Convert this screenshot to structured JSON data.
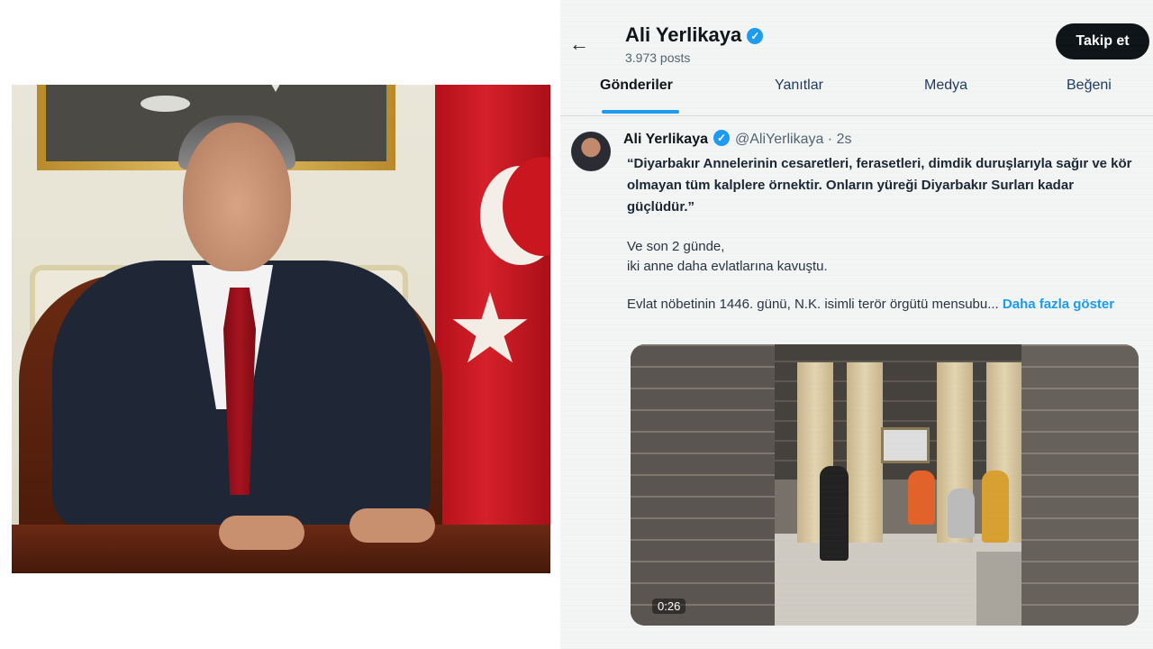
{
  "profile": {
    "name": "Ali Yerlikaya",
    "posts": "3.973 posts",
    "follow_label": "Takip et",
    "back": "←"
  },
  "tabs": [
    {
      "label": "Gönderiler",
      "active": true
    },
    {
      "label": "Yanıtlar",
      "active": false
    },
    {
      "label": "Medya",
      "active": false
    },
    {
      "label": "Beğeni",
      "active": false
    }
  ],
  "tweet": {
    "author": "Ali Yerlikaya",
    "handle": "@AliYerlikaya · 2s",
    "quote": "“Diyarbakır Annelerinin cesaretleri, ferasetleri, dimdik duruşlarıyla sağır ve kör olmayan tüm kalplere örnektir. Onların yüreği Diyarbakır Surları kadar güçlüdür.”",
    "line1": "Ve son 2 günde,",
    "line2": "iki anne daha evlatlarına kavuştu.",
    "line3": "Evlat nöbetinin 1446. günü, N.K. isimli terör örgütü mensubu...",
    "more": "Daha fazla göster",
    "video_duration": "0:26"
  },
  "colors": {
    "verified": "#1d9bf0",
    "flag_red": "#d5202a"
  },
  "icons": [
    "arrow-left-icon",
    "verified-badge-icon"
  ]
}
